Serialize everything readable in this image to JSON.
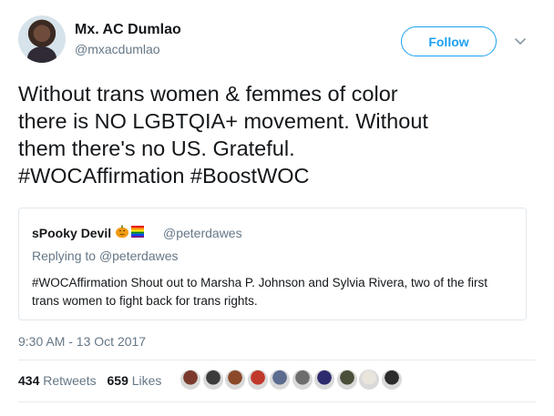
{
  "author": {
    "name": "Mx. AC Dumlao",
    "handle": "@mxacdumlao"
  },
  "follow_button": {
    "label": "Follow"
  },
  "tweet": {
    "lines": [
      "Without trans women & femmes of color",
      "there is NO LGBTQIA+ movement. Without",
      "them there's no US. Grateful.",
      "#WOCAffirmation #BoostWOC"
    ]
  },
  "quoted_tweet": {
    "name": "sPooky Devil",
    "name_emojis": [
      "jack-o-lantern-emoji",
      "rainbow-flag-emoji"
    ],
    "handle": "@peterdawes",
    "replying_prefix": "Replying to",
    "replying_handle": "@peterdawes",
    "text_lines": [
      "#WOCAffirmation Shout out to Marsha P. Johnson and Sylvia Rivera, two of the first",
      "trans women to fight back for trans rights."
    ]
  },
  "timestamp": "9:30 AM - 13 Oct 2017",
  "stats": {
    "retweets_count": "434",
    "retweets_label": "Retweets",
    "likes_count": "659",
    "likes_label": "Likes"
  },
  "likers": [
    {
      "name": "liker-avatar-1",
      "color": "#7a3b2e"
    },
    {
      "name": "liker-avatar-2",
      "color": "#3c3c3c"
    },
    {
      "name": "liker-avatar-3",
      "color": "#8a4a2a"
    },
    {
      "name": "liker-avatar-4",
      "color": "#c0392b"
    },
    {
      "name": "liker-avatar-5",
      "color": "#5b6c8f"
    },
    {
      "name": "liker-avatar-6",
      "color": "#6d6d6d"
    },
    {
      "name": "liker-avatar-7",
      "color": "#2d2a6e"
    },
    {
      "name": "liker-avatar-8",
      "color": "#4a4f3a"
    },
    {
      "name": "liker-avatar-9",
      "color": "#e9e4dc"
    },
    {
      "name": "liker-avatar-10",
      "color": "#2b2b2b"
    }
  ],
  "colors": {
    "accent": "#1da1f2",
    "secondary_text": "#657786",
    "primary_text": "#14171a",
    "border": "#e1e8ed"
  }
}
